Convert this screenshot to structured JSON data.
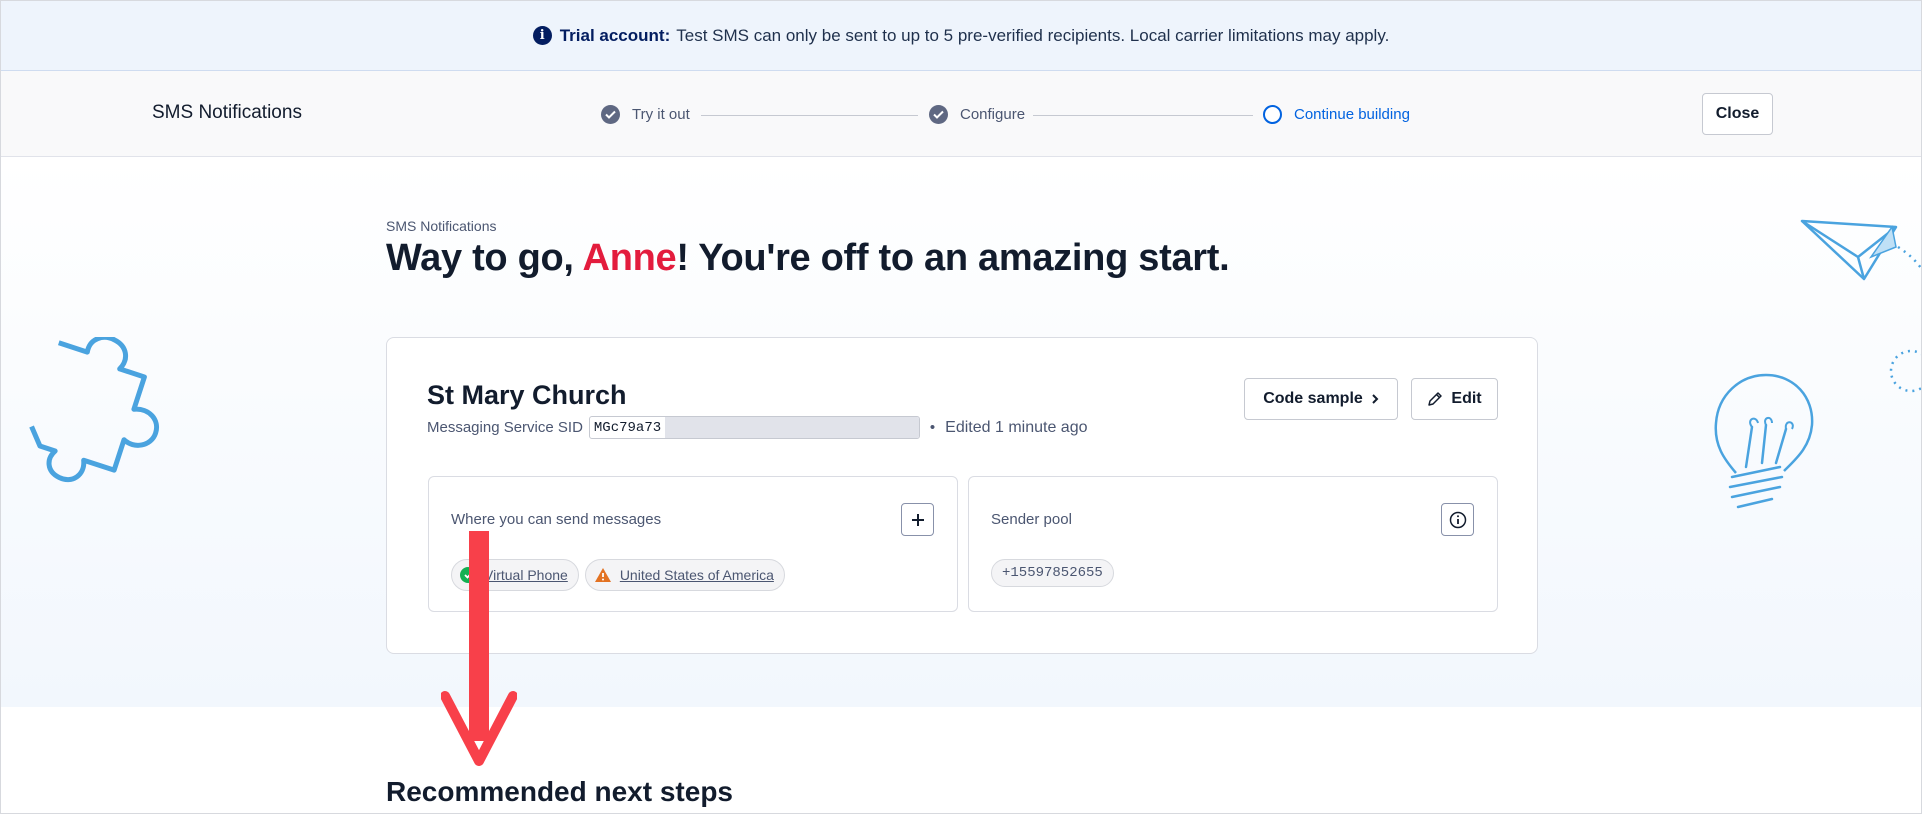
{
  "banner": {
    "info_icon": "info-icon",
    "bold": "Trial account:",
    "message": "Test SMS can only be sent to up to 5 pre-verified recipients. Local carrier limitations may apply."
  },
  "header": {
    "title": "SMS Notifications",
    "close_label": "Close",
    "steps": [
      {
        "label": "Try it out",
        "state": "complete"
      },
      {
        "label": "Configure",
        "state": "complete"
      },
      {
        "label": "Continue building",
        "state": "current"
      }
    ]
  },
  "hero": {
    "breadcrumb": "SMS Notifications",
    "title_prefix": "Way to go, ",
    "title_name": "Anne",
    "title_suffix": "! You're off to an amazing start."
  },
  "service": {
    "name": "St Mary Church",
    "sid_label": "Messaging Service SID",
    "sid_value": "MGc79a73",
    "separator": "•",
    "edited": "Edited 1 minute ago",
    "code_sample_label": "Code sample",
    "edit_label": "Edit",
    "destinations": {
      "title": "Where you can send messages",
      "chips": [
        {
          "label": "Virtual Phone",
          "status": "ok"
        },
        {
          "label": "United States of America",
          "status": "warning"
        }
      ]
    },
    "sender_pool": {
      "title": "Sender pool",
      "numbers": [
        "+15597852655"
      ]
    }
  },
  "next_steps": {
    "heading": "Recommended next steps"
  },
  "colors": {
    "accent": "#0263e0",
    "name_highlight": "#e31c3d",
    "annotation_arrow": "#f8404a",
    "illustration": "#4aa3df"
  }
}
